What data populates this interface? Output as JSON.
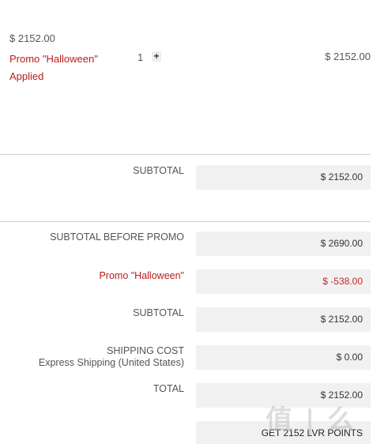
{
  "cart_item": {
    "unit_price": "$ 2152.00",
    "promo_text": "Promo \"Halloween\" Applied",
    "quantity": "1",
    "plus_symbol": "+",
    "line_total": "$ 2152.00"
  },
  "subtotal_section": {
    "label": "SUBTOTAL",
    "value": "$ 2152.00"
  },
  "summary": {
    "subtotal_before_promo": {
      "label": "SUBTOTAL BEFORE PROMO",
      "value": "$ 2690.00"
    },
    "promo": {
      "label": "Promo \"Halloween\"",
      "value": "$ -538.00"
    },
    "subtotal": {
      "label": "SUBTOTAL",
      "value": "$ 2152.00"
    },
    "shipping": {
      "label": "SHIPPING COST",
      "method": "Express Shipping (United States)",
      "value": "$ 0.00"
    },
    "total": {
      "label": "TOTAL",
      "value": "$ 2152.00"
    },
    "points": {
      "value": "GET 2152 LVR POINTS"
    }
  },
  "watermark_text": "值 | 么值得买",
  "colors": {
    "promo_red": "#b71c1c",
    "box_background": "#f1f1f1",
    "divider": "#cfcfcf"
  }
}
